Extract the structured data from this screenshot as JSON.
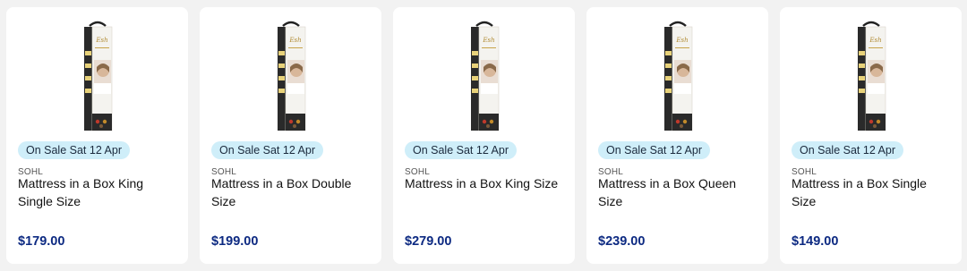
{
  "products": [
    {
      "badge": "On Sale Sat 12 Apr",
      "brand": "SOHL",
      "title": "Mattress in a Box King Single Size",
      "price": "$179.00",
      "image_icon": "mattress-box-image"
    },
    {
      "badge": "On Sale Sat 12 Apr",
      "brand": "SOHL",
      "title": "Mattress in a Box Double Size",
      "price": "$199.00",
      "image_icon": "mattress-box-image"
    },
    {
      "badge": "On Sale Sat 12 Apr",
      "brand": "SOHL",
      "title": "Mattress in a Box King Size",
      "price": "$279.00",
      "image_icon": "mattress-box-image"
    },
    {
      "badge": "On Sale Sat 12 Apr",
      "brand": "SOHL",
      "title": "Mattress in a Box Queen Size",
      "price": "$239.00",
      "image_icon": "mattress-box-image"
    },
    {
      "badge": "On Sale Sat 12 Apr",
      "brand": "SOHL",
      "title": "Mattress in a Box Single Size",
      "price": "$149.00",
      "image_icon": "mattress-box-image"
    }
  ],
  "colors": {
    "background": "#f2f2f2",
    "card": "#ffffff",
    "badge_bg": "#cfeef9",
    "price": "#0d2a82"
  }
}
